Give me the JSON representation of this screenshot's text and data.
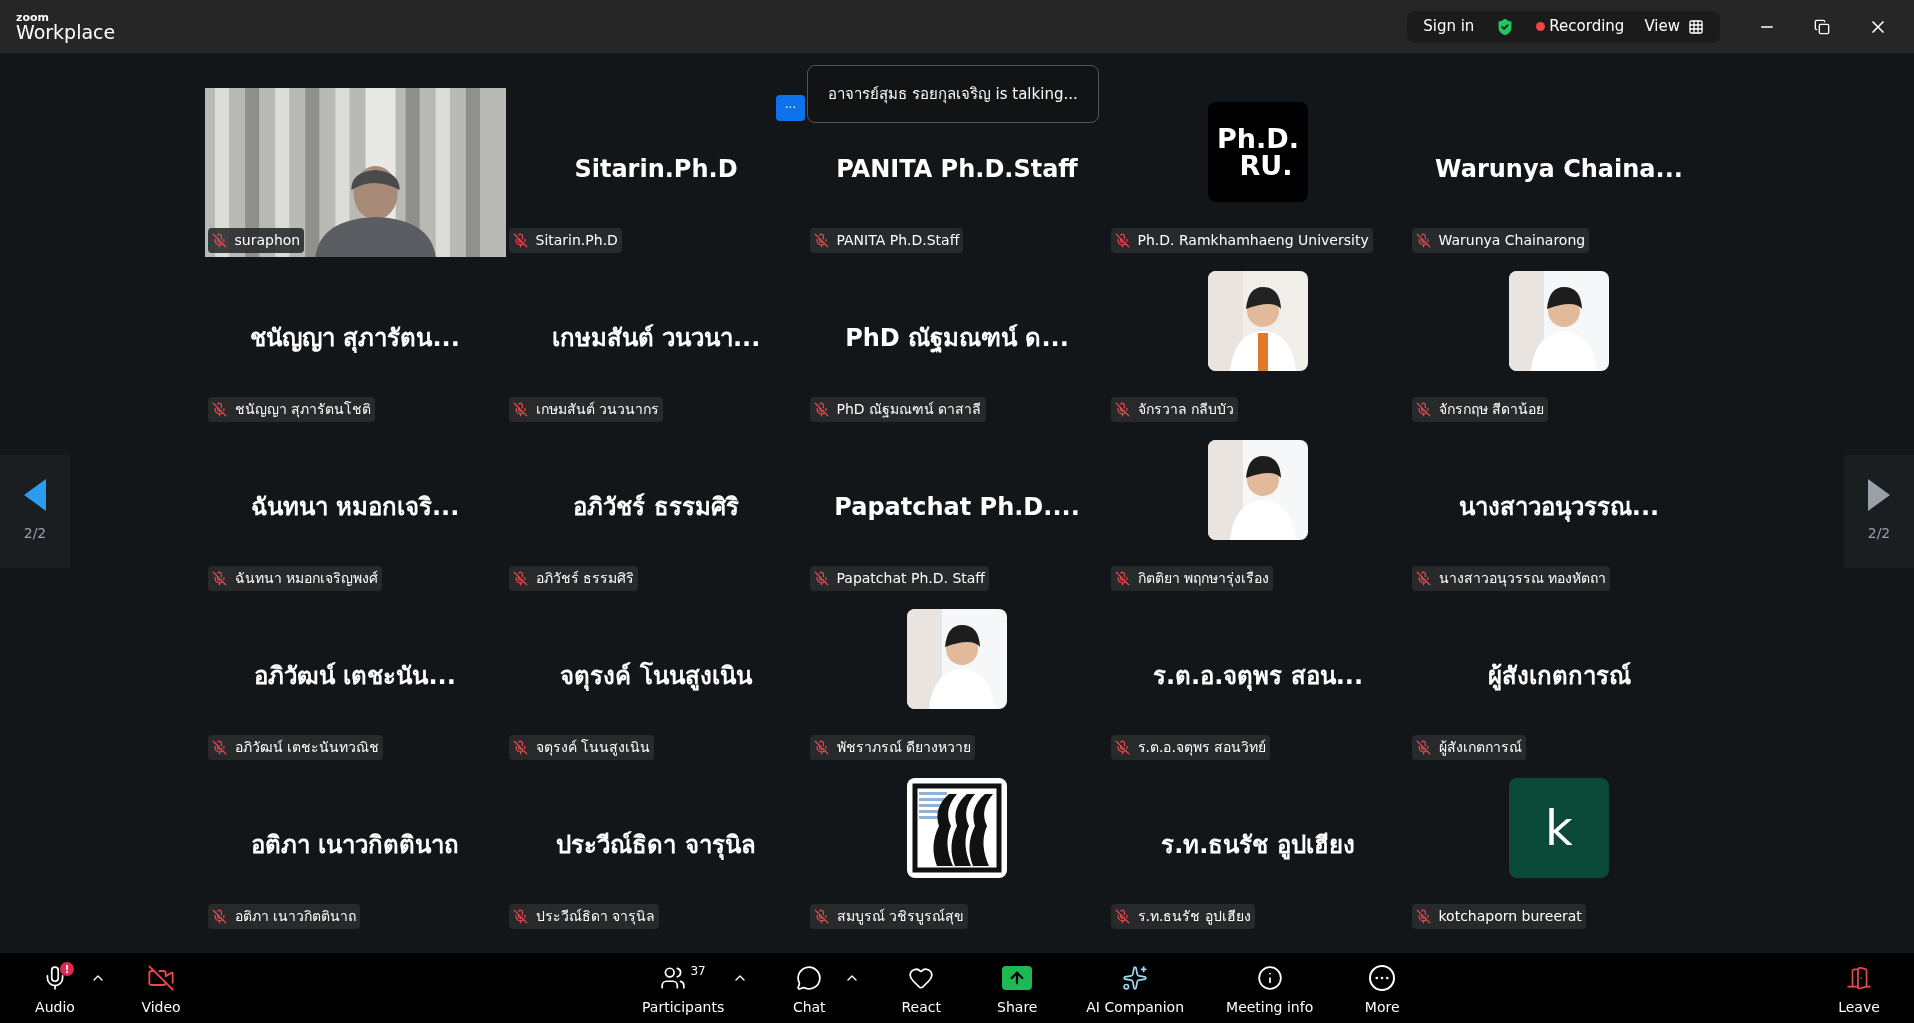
{
  "app": {
    "logo_small": "zoom",
    "logo_large": "Workplace"
  },
  "top_bar": {
    "sign_in": "Sign in",
    "recording": "Recording",
    "recording_on": true,
    "view": "View"
  },
  "talking": {
    "more": "···",
    "text": "อาจารย์สุมธ  รอยกุลเจริญ is talking..."
  },
  "pager": {
    "left": "2/2",
    "right": "2/2"
  },
  "tiles": [
    {
      "kind": "video",
      "label": "suraphon",
      "muted": true
    },
    {
      "kind": "name",
      "display": "Sitarin.Ph.D",
      "label": "Sitarin.Ph.D",
      "muted": true
    },
    {
      "kind": "name",
      "display": "PANITA Ph.D.Staff",
      "label": "PANITA Ph.D.Staff",
      "muted": true
    },
    {
      "kind": "logo_text",
      "logo": [
        "Ph.D.",
        "RU."
      ],
      "label": "Ph.D. Ramkhamhaeng University",
      "muted": true
    },
    {
      "kind": "name",
      "display": "Warunya  Chaina...",
      "label": "Warunya Chainarong",
      "muted": true
    },
    {
      "kind": "name",
      "display": "ชนัญญา สุภารัตน...",
      "label": "ชนัญญา สุภารัตนโชติ",
      "muted": true
    },
    {
      "kind": "name",
      "display": "เกษมสันต์ วนวนา...",
      "label": "เกษมสันต์ วนวนากร",
      "muted": true
    },
    {
      "kind": "name",
      "display": "PhD ณัฐมณฑน์ ด...",
      "label": "PhD ณัฐมณฑน์ ดาสาลี",
      "muted": true
    },
    {
      "label": "จักรวาล กลีบบัว",
      "muted": true
    },
    {
      "label": "จักรกฤษ สีดาน้อย",
      "muted": true
    },
    {
      "kind": "name",
      "display": "ฉันทนา หมอกเจริ...",
      "label": "ฉันทนา หมอกเจริญพงศ์",
      "muted": true
    },
    {
      "kind": "name",
      "display": "อภิวัชร์ ธรรมศิริ",
      "label": "อภิวัชร์ ธรรมศิริ",
      "muted": true
    },
    {
      "kind": "name",
      "display": "Papatchat  Ph.D....",
      "label": "Papatchat Ph.D. Staff",
      "muted": true
    },
    {
      "label": "กิตติยา พฤกษารุ่งเรือง",
      "muted": true
    },
    {
      "kind": "name",
      "display": "นางสาวอนุวรรณ...",
      "label": "นางสาวอนุวรรณ ทองหัตถา",
      "muted": true
    },
    {
      "kind": "name",
      "display": "อภิวัฒน์ เตชะนัน...",
      "label": "อภิวัฒน์ เตชะนันทวณิช",
      "muted": true
    },
    {
      "kind": "name",
      "display": "จตุรงค์ โนนสูงเนิน",
      "label": "จตุรงค์ โนนสูงเนิน",
      "muted": true
    },
    {
      "label": "พัชราภรณ์ ดียางหวาย",
      "muted": true
    },
    {
      "kind": "name",
      "display": "ร.ต.อ.จตุพร  สอน...",
      "label": "ร.ต.อ.จตุพร  สอนวิทย์",
      "muted": true
    },
    {
      "kind": "name",
      "display": "ผู้สังเกตการณ์",
      "label": "ผู้สังเกตการณ์",
      "muted": true
    },
    {
      "kind": "name",
      "display": "อติภา เนาวกิตตินาถ",
      "label": "อติภา เนาวกิตตินาถ",
      "muted": true
    },
    {
      "kind": "name",
      "display": "ประวีณ์ธิดา จารุนิล",
      "label": "ประวีณ์ธิดา จารุนิล",
      "muted": true
    },
    {
      "kind": "logo_drawing",
      "label": "สมบูรณ์ วชิรบูรณ์สุข",
      "muted": true
    },
    {
      "kind": "name",
      "display": "ร.ท.ธนรัช  อูปเฮียง",
      "label": "ร.ท.ธนรัช  อูปเฮียง",
      "muted": true
    },
    {
      "kind": "letter",
      "letter": "k",
      "label": "kotchaporn bureerat",
      "muted": true
    }
  ],
  "toolbar": {
    "audio": {
      "label": "Audio",
      "alert": "!",
      "caret": true
    },
    "video": {
      "label": "Video",
      "off": true
    },
    "center": [
      {
        "kind": "participants",
        "label": "Participants",
        "count": "37",
        "caret": true
      },
      {
        "kind": "chat",
        "label": "Chat",
        "caret": true
      },
      {
        "kind": "react",
        "label": "React"
      },
      {
        "kind": "share",
        "label": "Share"
      },
      {
        "kind": "ai",
        "label": "AI Companion"
      },
      {
        "kind": "info",
        "label": "Meeting info"
      },
      {
        "kind": "more",
        "label": "More"
      }
    ],
    "leave": "Leave"
  }
}
